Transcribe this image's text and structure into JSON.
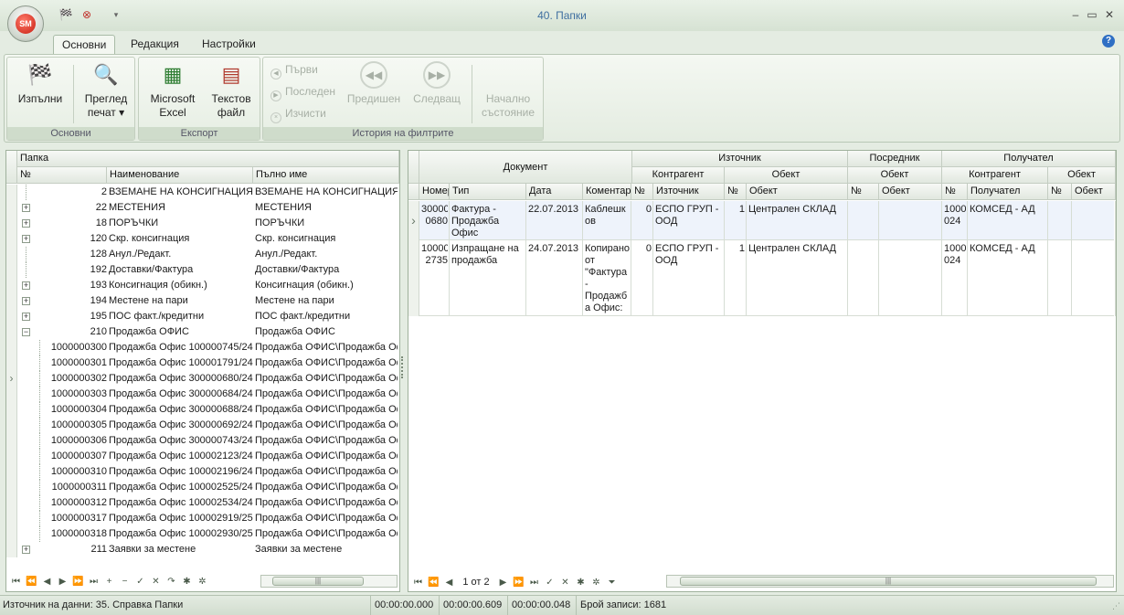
{
  "window": {
    "title": "40. Папки",
    "logo_text": "SM"
  },
  "tabs": [
    "Основни",
    "Редакция",
    "Настройки"
  ],
  "ribbon": {
    "groups": [
      {
        "label": "Основни",
        "buttons": [
          "Изпълни",
          "Преглед печат ▾"
        ]
      },
      {
        "label": "Експорт",
        "buttons": [
          "Microsoft Excel",
          "Текстов файл"
        ]
      },
      {
        "label": "История на филтрите",
        "small_buttons": [
          "Първи",
          "Последен",
          "Изчисти"
        ],
        "buttons": [
          "Предишен",
          "Следващ",
          "Начално състояние"
        ]
      }
    ]
  },
  "tree": {
    "group_header": "Папка",
    "columns": [
      "№",
      "Наименование",
      "Пълно име"
    ],
    "rows": [
      {
        "no": "2",
        "name": "ВЗЕМАНЕ НА КОНСИГНАЦИЯ",
        "full": "ВЗЕМАНЕ НА КОНСИГНАЦИЯ",
        "exp": "",
        "lvl": 0
      },
      {
        "no": "22",
        "name": "МЕСТЕНИЯ",
        "full": "МЕСТЕНИЯ",
        "exp": "+",
        "lvl": 0
      },
      {
        "no": "18",
        "name": "ПОРЪЧКИ",
        "full": "ПОРЪЧКИ",
        "exp": "+",
        "lvl": 0
      },
      {
        "no": "120",
        "name": "Скр. консигнация",
        "full": "Скр. консигнация",
        "exp": "+",
        "lvl": 0
      },
      {
        "no": "128",
        "name": "Анул./Редакт.",
        "full": "Анул./Редакт.",
        "exp": "",
        "lvl": 0
      },
      {
        "no": "192",
        "name": "Доставки/Фактура",
        "full": "Доставки/Фактура",
        "exp": "",
        "lvl": 0
      },
      {
        "no": "193",
        "name": "Консигнация (обикн.)",
        "full": "Консигнация (обикн.)",
        "exp": "+",
        "lvl": 0
      },
      {
        "no": "194",
        "name": "Местене на пари",
        "full": "Местене на пари",
        "exp": "+",
        "lvl": 0
      },
      {
        "no": "195",
        "name": "ПОС факт./кредитни",
        "full": "ПОС факт./кредитни",
        "exp": "+",
        "lvl": 0
      },
      {
        "no": "210",
        "name": "Продажба ОФИС",
        "full": "Продажба ОФИС",
        "exp": "−",
        "lvl": 0
      },
      {
        "no": "1000000300",
        "name": "Продажба Офис 100000745/24,",
        "full": "Продажба ОФИС\\Продажба Оф",
        "exp": "",
        "lvl": 1
      },
      {
        "no": "1000000301",
        "name": "Продажба Офис 100001791/24,",
        "full": "Продажба ОФИС\\Продажба Оф",
        "exp": "",
        "lvl": 1
      },
      {
        "no": "1000000302",
        "name": "Продажба Офис 300000680/24,",
        "full": "Продажба ОФИС\\Продажба Оф",
        "exp": "",
        "lvl": 1,
        "current": true
      },
      {
        "no": "1000000303",
        "name": "Продажба Офис 300000684/24,",
        "full": "Продажба ОФИС\\Продажба Оф",
        "exp": "",
        "lvl": 1
      },
      {
        "no": "1000000304",
        "name": "Продажба Офис 300000688/24,",
        "full": "Продажба ОФИС\\Продажба Оф",
        "exp": "",
        "lvl": 1
      },
      {
        "no": "1000000305",
        "name": "Продажба Офис 300000692/24,",
        "full": "Продажба ОФИС\\Продажба Оф",
        "exp": "",
        "lvl": 1
      },
      {
        "no": "1000000306",
        "name": "Продажба Офис 300000743/24,",
        "full": "Продажба ОФИС\\Продажба Оф",
        "exp": "",
        "lvl": 1
      },
      {
        "no": "1000000307",
        "name": "Продажба Офис 100002123/24,",
        "full": "Продажба ОФИС\\Продажба Оф",
        "exp": "",
        "lvl": 1
      },
      {
        "no": "1000000310",
        "name": "Продажба Офис 100002196/24,",
        "full": "Продажба ОФИС\\Продажба Оф",
        "exp": "",
        "lvl": 1
      },
      {
        "no": "1000000311",
        "name": "Продажба Офис 100002525/24,",
        "full": "Продажба ОФИС\\Продажба Оф",
        "exp": "",
        "lvl": 1
      },
      {
        "no": "1000000312",
        "name": "Продажба Офис 100002534/24,",
        "full": "Продажба ОФИС\\Продажба Оф",
        "exp": "",
        "lvl": 1
      },
      {
        "no": "1000000317",
        "name": "Продажба Офис 100002919/25,",
        "full": "Продажба ОФИС\\Продажба Оф",
        "exp": "",
        "lvl": 1
      },
      {
        "no": "1000000318",
        "name": "Продажба Офис 100002930/25,",
        "full": "Продажба ОФИС\\Продажба Оф",
        "exp": "",
        "lvl": 1
      },
      {
        "no": "211",
        "name": "Заявки за местене",
        "full": "Заявки за местене",
        "exp": "+",
        "lvl": 0
      }
    ]
  },
  "docs": {
    "bands": {
      "document": "Документ",
      "source": "Източник",
      "intermediary": "Посредник",
      "receiver": "Получател",
      "counterparty": "Контрагент",
      "object": "Обект"
    },
    "columns": [
      "Номер",
      "Тип",
      "Дата",
      "Коментар",
      "№",
      "Източник",
      "№",
      "Обект",
      "№",
      "Обект",
      "№",
      "Получател",
      "№",
      "Обект"
    ],
    "rows": [
      {
        "num": "30000\n0680",
        "type": "Фактура -\nПродажба\nОфис",
        "date": "22.07.2013",
        "comment": "Каблешк\nов",
        "sno": "0",
        "source": "ЕСПО ГРУП -\nООД",
        "sobjno": "1",
        "sobj": "Централен СКЛАД",
        "ino": "",
        "iobj": "",
        "rno": "1000\n024",
        "receiver": "КОМСЕД - АД",
        "robjno": "",
        "robj": ""
      },
      {
        "num": "10000\n2735",
        "type": "Изпращане на\nпродажба",
        "date": "24.07.2013",
        "comment": "Копирано\nот\n\"Фактура\n-\nПродажб\nа Офис:",
        "sno": "0",
        "source": "ЕСПО ГРУП -\nООД",
        "sobjno": "1",
        "sobj": "Централен СКЛАД",
        "ino": "",
        "iobj": "",
        "rno": "1000\n024",
        "receiver": "КОМСЕД - АД",
        "robjno": "",
        "robj": ""
      }
    ],
    "pager": "1 от 2"
  },
  "status": {
    "source": "Източник на данни: 35. Справка Папки",
    "t1": "00:00:00.000",
    "t2": "00:00:00.609",
    "t3": "00:00:00.048",
    "count": "Брой записи: 1681"
  }
}
